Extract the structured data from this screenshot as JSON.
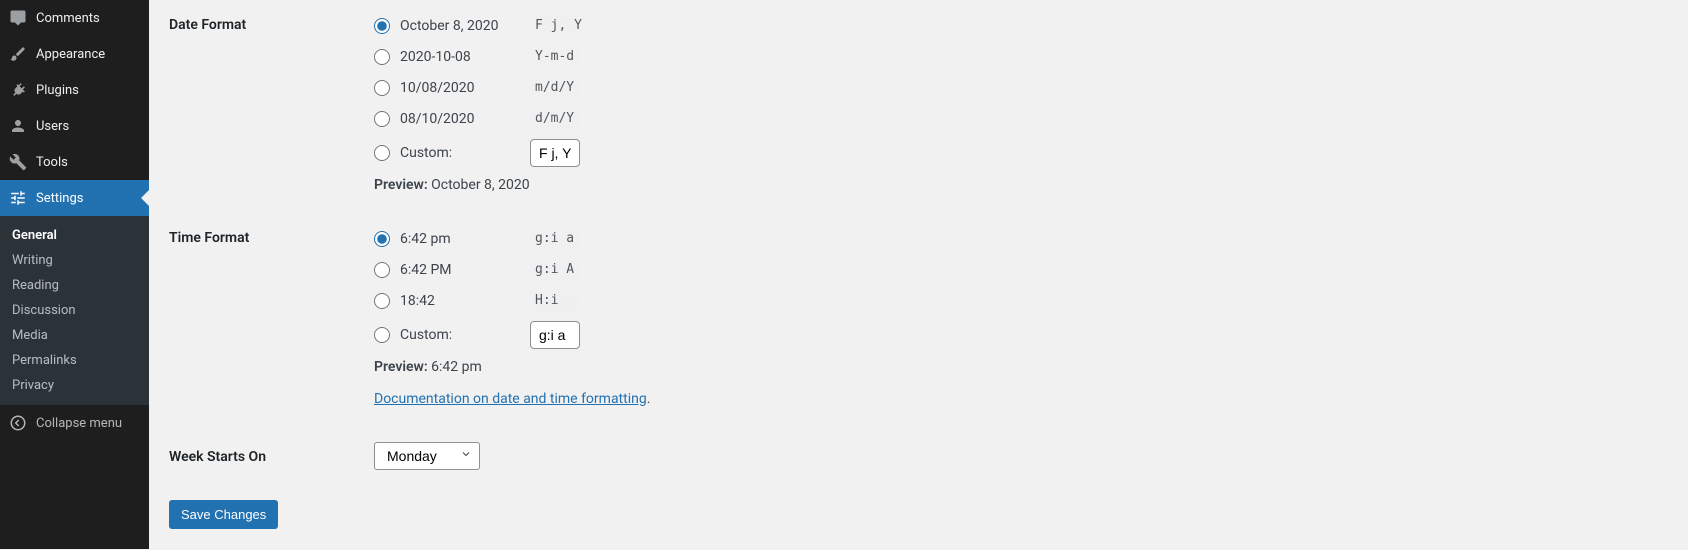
{
  "sidebar": {
    "top": [
      {
        "label": "Comments",
        "icon": "comment"
      },
      {
        "label": "Appearance",
        "icon": "brush"
      },
      {
        "label": "Plugins",
        "icon": "plug"
      },
      {
        "label": "Users",
        "icon": "user"
      },
      {
        "label": "Tools",
        "icon": "wrench"
      },
      {
        "label": "Settings",
        "icon": "sliders",
        "active": true
      }
    ],
    "sub": [
      {
        "label": "General",
        "current": true
      },
      {
        "label": "Writing"
      },
      {
        "label": "Reading"
      },
      {
        "label": "Discussion"
      },
      {
        "label": "Media"
      },
      {
        "label": "Permalinks"
      },
      {
        "label": "Privacy"
      }
    ],
    "collapse": "Collapse menu"
  },
  "labels": {
    "date_format": "Date Format",
    "time_format": "Time Format",
    "week_starts": "Week Starts On",
    "preview": "Preview:",
    "custom": "Custom:",
    "save": "Save Changes",
    "doc_link": "Documentation on date and time formatting"
  },
  "date": {
    "options": [
      {
        "display": "October 8, 2020",
        "code": "F j, Y",
        "checked": true
      },
      {
        "display": "2020-10-08",
        "code": "Y-m-d"
      },
      {
        "display": "10/08/2020",
        "code": "m/d/Y"
      },
      {
        "display": "08/10/2020",
        "code": "d/m/Y"
      }
    ],
    "custom_value": "F j, Y",
    "preview_value": "October 8, 2020"
  },
  "time": {
    "options": [
      {
        "display": "6:42 pm",
        "code": "g:i a",
        "checked": true
      },
      {
        "display": "6:42 PM",
        "code": "g:i A"
      },
      {
        "display": "18:42",
        "code": "H:i"
      }
    ],
    "custom_value": "g:i a",
    "preview_value": "6:42 pm"
  },
  "week": {
    "selected": "Monday"
  }
}
